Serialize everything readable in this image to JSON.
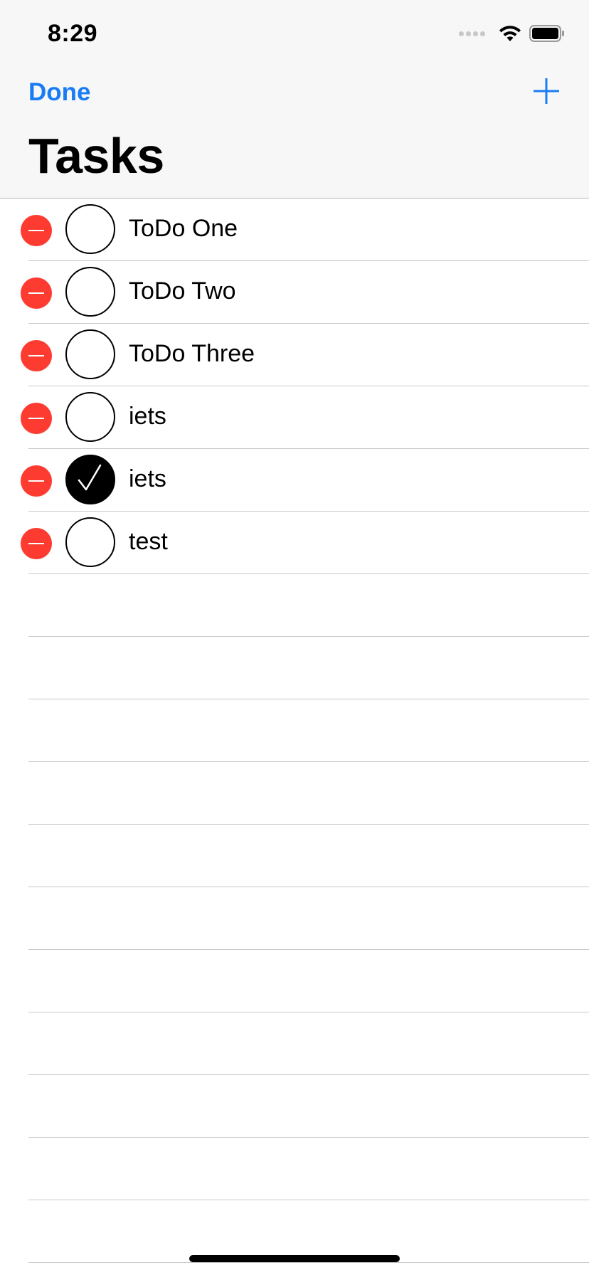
{
  "status_bar": {
    "time": "8:29"
  },
  "nav": {
    "done_label": "Done",
    "add_icon": "plus-icon",
    "title": "Tasks"
  },
  "tasks": [
    {
      "label": "ToDo One",
      "completed": false
    },
    {
      "label": "ToDo Two",
      "completed": false
    },
    {
      "label": "ToDo Three",
      "completed": false
    },
    {
      "label": "iets",
      "completed": false
    },
    {
      "label": "iets",
      "completed": true
    },
    {
      "label": "test",
      "completed": false
    }
  ],
  "empty_row_count": 11,
  "colors": {
    "accent": "#1a7cf5",
    "delete": "#fe3b30",
    "header_bg": "#f7f7f7",
    "separator": "#c8c8cc"
  }
}
